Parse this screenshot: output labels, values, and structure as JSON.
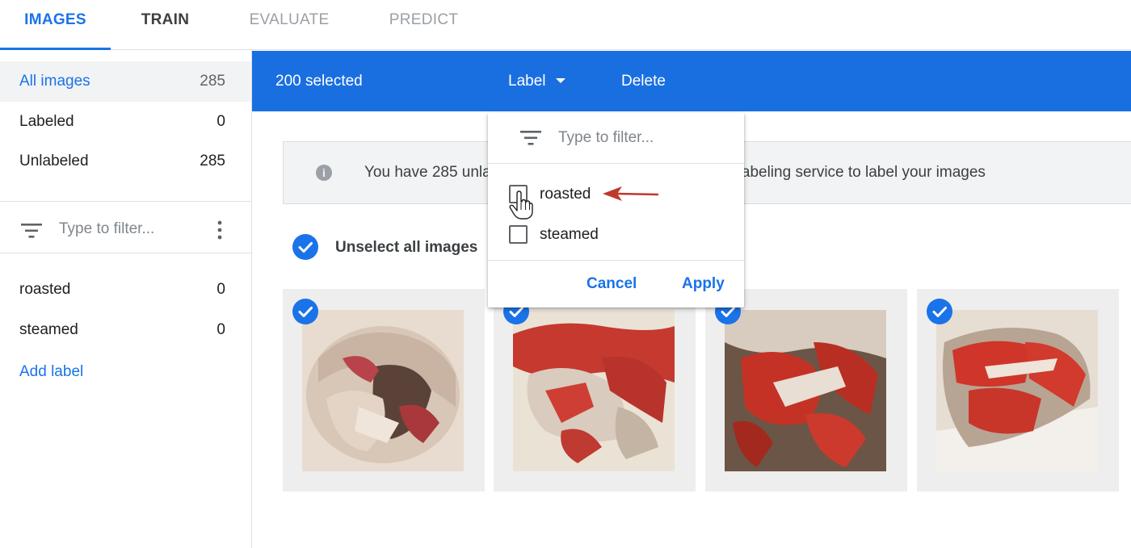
{
  "tabs": [
    "IMAGES",
    "TRAIN",
    "EVALUATE",
    "PREDICT"
  ],
  "sidebar": {
    "nav": [
      {
        "label": "All images",
        "count": "285"
      },
      {
        "label": "Labeled",
        "count": "0"
      },
      {
        "label": "Unlabeled",
        "count": "285"
      }
    ],
    "filter_placeholder": "Type to filter...",
    "labels": [
      {
        "label": "roasted",
        "count": "0"
      },
      {
        "label": "steamed",
        "count": "0"
      }
    ],
    "add_label": "Add label"
  },
  "selection_bar": {
    "count": "200 selected",
    "label_button": "Label",
    "delete_button": "Delete"
  },
  "banner": {
    "text": "You have 285 unlabeled images. Use Google’s human labeling service to label your images"
  },
  "unselect_all": "Unselect all images",
  "dropdown": {
    "filter_placeholder": "Type to filter...",
    "options": [
      "roasted",
      "steamed"
    ],
    "cancel": "Cancel",
    "apply": "Apply"
  },
  "images": [
    {
      "selected": true,
      "icon": "check-icon"
    },
    {
      "selected": true,
      "icon": "check-icon"
    },
    {
      "selected": true,
      "icon": "check-icon"
    },
    {
      "selected": true,
      "icon": "check-icon"
    }
  ],
  "colors": {
    "accent": "#1a73e8",
    "bar": "#1a6fe0",
    "annotation_arrow": "#c0392b"
  }
}
